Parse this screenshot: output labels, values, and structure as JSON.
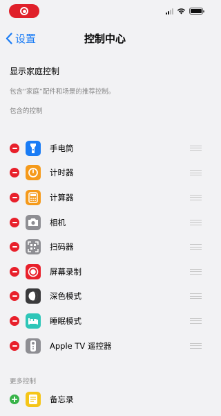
{
  "nav": {
    "back_label": "设置",
    "title": "控制中心"
  },
  "home_control": {
    "label": "显示家庭控制",
    "note": "包含“家庭”配件和场景的推荐控制。"
  },
  "included": {
    "header": "包含的控制",
    "items": [
      {
        "label": "手电筒",
        "icon": "flashlight-icon",
        "color": "#1a7cf5"
      },
      {
        "label": "计时器",
        "icon": "timer-icon",
        "color": "#f59a1b"
      },
      {
        "label": "计算器",
        "icon": "calculator-icon",
        "color": "#f59a1b"
      },
      {
        "label": "相机",
        "icon": "camera-icon",
        "color": "#8e8e93"
      },
      {
        "label": "扫码器",
        "icon": "qr-scanner-icon",
        "color": "#8e8e93"
      },
      {
        "label": "屏幕录制",
        "icon": "screen-record-icon",
        "color": "#e8202b"
      },
      {
        "label": "深色模式",
        "icon": "dark-mode-icon",
        "color": "#3a3a3c"
      },
      {
        "label": "睡眠模式",
        "icon": "sleep-mode-icon",
        "color": "#2ec6b8"
      },
      {
        "label": "Apple TV 遥控器",
        "icon": "apple-tv-remote-icon",
        "color": "#8e8e93"
      }
    ]
  },
  "more": {
    "header": "更多控制",
    "items": [
      {
        "label": "备忘录",
        "icon": "notes-icon",
        "color": "#f5c518"
      }
    ]
  }
}
